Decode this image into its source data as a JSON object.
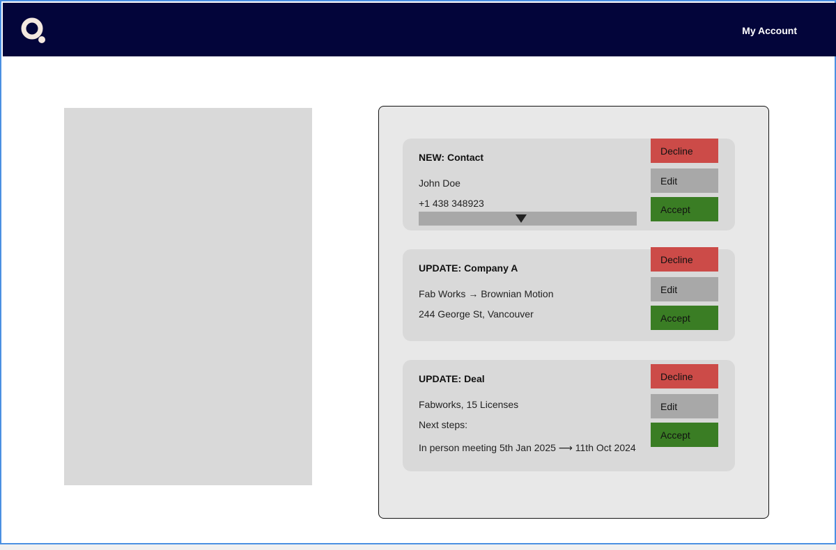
{
  "header": {
    "account_label": "My Account"
  },
  "cards": [
    {
      "title": "NEW: Contact",
      "lines": [
        "John Doe",
        "+1 438 348923"
      ],
      "buttons": {
        "decline": "Decline",
        "edit": "Edit",
        "accept": "Accept"
      }
    },
    {
      "title": "UPDATE: Company A",
      "lines": [
        "Fab Works → Brownian Motion",
        "244 George St, Vancouver"
      ],
      "buttons": {
        "decline": "Decline",
        "edit": "Edit",
        "accept": "Accept"
      }
    },
    {
      "title": "UPDATE: Deal",
      "lines": [
        "Fabworks, 15 Licenses",
        "Next steps:",
        "In person meeting 5th Jan 2025 ⟶ 11th Oct 2024"
      ],
      "buttons": {
        "decline": "Decline",
        "edit": "Edit",
        "accept": "Accept"
      }
    }
  ],
  "colors": {
    "header_bg": "#03053a",
    "decline": "#cc4b48",
    "edit": "#a8a8a8",
    "accept": "#3a7d24"
  },
  "icons": {
    "logo": "q-logo-icon",
    "expand": "triangle-down-icon"
  }
}
